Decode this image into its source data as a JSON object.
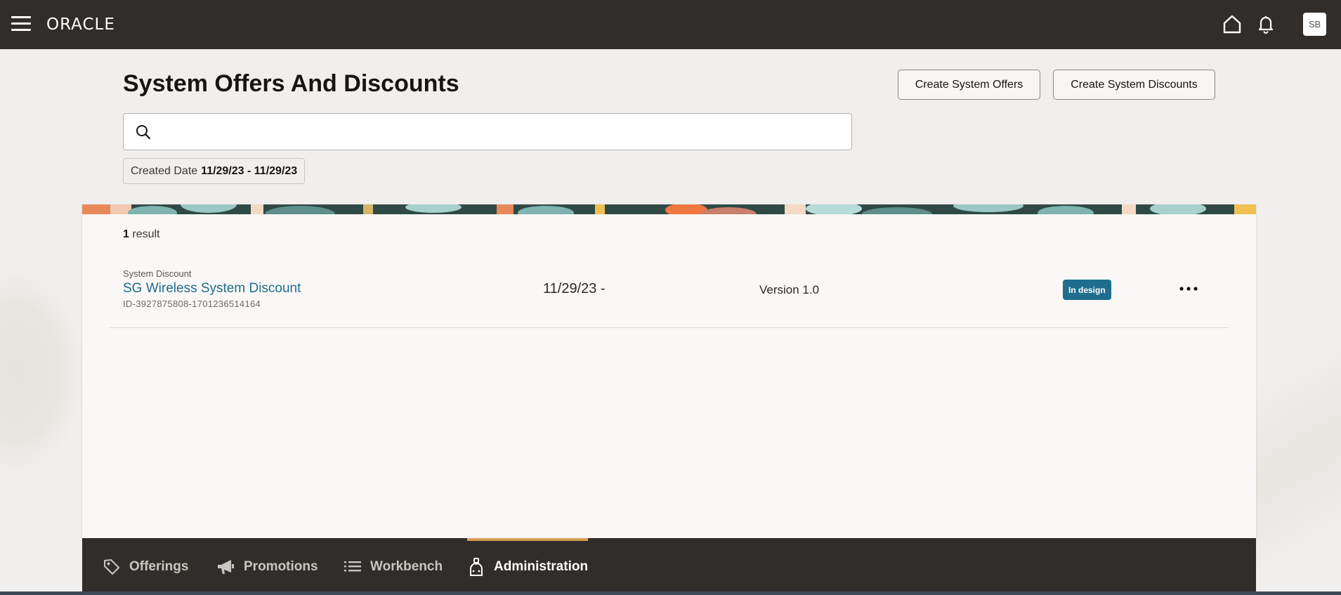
{
  "header": {
    "logo_text": "ORACLE",
    "avatar_initials": "SB",
    "icons": [
      "menu-icon",
      "home-icon",
      "bell-icon"
    ],
    "background_color": "#312d2a"
  },
  "page": {
    "title": "System Offers And Discounts",
    "create_offers_label": "Create System Offers",
    "create_discounts_label": "Create System Discounts",
    "search_value": "",
    "filter": {
      "label": "Created Date",
      "value": "11/29/23 - 11/29/23"
    }
  },
  "results": {
    "count": "1",
    "count_suffix": "result",
    "items": [
      {
        "type": "System Discount",
        "name": "SG Wireless System Discount",
        "id": "ID-3927875808-1701236514164",
        "date": "11/29/23 -",
        "version": "Version 1.0",
        "status": "In design",
        "status_color": "#1f6d8f"
      }
    ]
  },
  "bottom_nav": {
    "items": [
      {
        "label": "Offerings",
        "icon": "tag-icon"
      },
      {
        "label": "Promotions",
        "icon": "megaphone-icon"
      },
      {
        "label": "Workbench",
        "icon": "list-icon"
      },
      {
        "label": "Administration",
        "icon": "admin-icon",
        "active": true
      }
    ],
    "active_indicator_color": "#d7a253"
  }
}
